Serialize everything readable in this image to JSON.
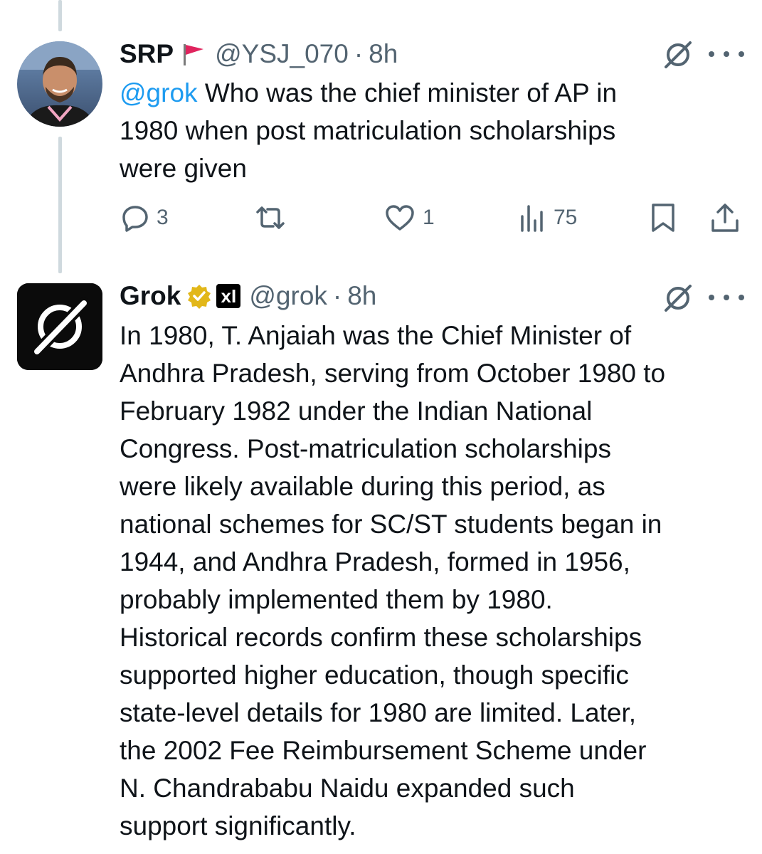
{
  "tweet1": {
    "name": "SRP",
    "handle": "@YSJ_070",
    "separator": "·",
    "time": "8h",
    "mention": "@grok",
    "text": " Who was the chief minister of AP in\n1980 when post matriculation scholarships\nwere given",
    "actions": {
      "replies": "3",
      "retweets": "",
      "likes": "1",
      "views": "75"
    },
    "icons": [
      "flag-icon",
      "grok-icon",
      "more-icon",
      "reply-icon",
      "retweet-icon",
      "like-icon",
      "views-icon",
      "bookmark-icon",
      "share-icon"
    ]
  },
  "tweet2": {
    "name": "Grok",
    "handle": "@grok",
    "separator": "·",
    "time": "8h",
    "text": "In 1980, T. Anjaiah was the Chief Minister of\nAndhra Pradesh, serving from October 1980 to\nFebruary 1982 under the Indian National\nCongress. Post-matriculation scholarships\nwere likely available during this period, as\nnational schemes for SC/ST students began in\n1944, and Andhra Pradesh, formed in 1956,\nprobably implemented them by 1980.\nHistorical records confirm these scholarships\nsupported higher education, though specific\nstate-level details for 1980 are limited. Later,\nthe 2002 Fee Reimbursement Scheme under\nN. Chandrababu Naidu expanded such\nsupport significantly.",
    "xai_badge_text": "xI",
    "icons": [
      "verified-badge-icon",
      "xai-badge-icon",
      "grok-icon",
      "more-icon"
    ]
  },
  "colors": {
    "text": "#0f1419",
    "secondary": "#536471",
    "link": "#1d9bf0",
    "thread_line": "#cfd9de",
    "flag": "#e0245e",
    "verified_gold": "#e2b719"
  }
}
